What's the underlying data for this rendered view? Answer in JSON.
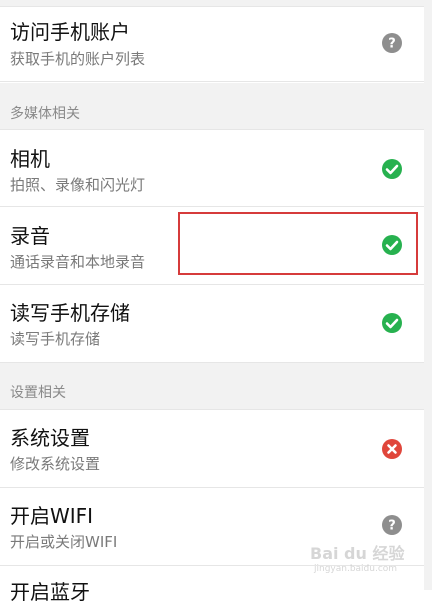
{
  "items": [
    {
      "title": "访问手机账户",
      "subtitle": "获取手机的账户列表",
      "status": "unknown"
    },
    {
      "title": "相机",
      "subtitle": "拍照、录像和闪光灯",
      "status": "allowed"
    },
    {
      "title": "录音",
      "subtitle": "通话录音和本地录音",
      "status": "allowed"
    },
    {
      "title": "读写手机存储",
      "subtitle": "读写手机存储",
      "status": "allowed"
    },
    {
      "title": "系统设置",
      "subtitle": "修改系统设置",
      "status": "denied"
    },
    {
      "title": "开启WIFI",
      "subtitle": "开启或关闭WIFI",
      "status": "unknown"
    },
    {
      "title": "开启蓝牙",
      "subtitle": "",
      "status": ""
    }
  ],
  "sections": [
    {
      "label": "多媒体相关"
    },
    {
      "label": "设置相关"
    }
  ],
  "watermark": {
    "brand": "Bai du 经验",
    "url": "jingyan.baidu.com"
  },
  "colors": {
    "allowed": "#27b14f",
    "denied": "#e0463b",
    "unknown": "#8e8e8e",
    "highlight": "#d63b3b"
  }
}
